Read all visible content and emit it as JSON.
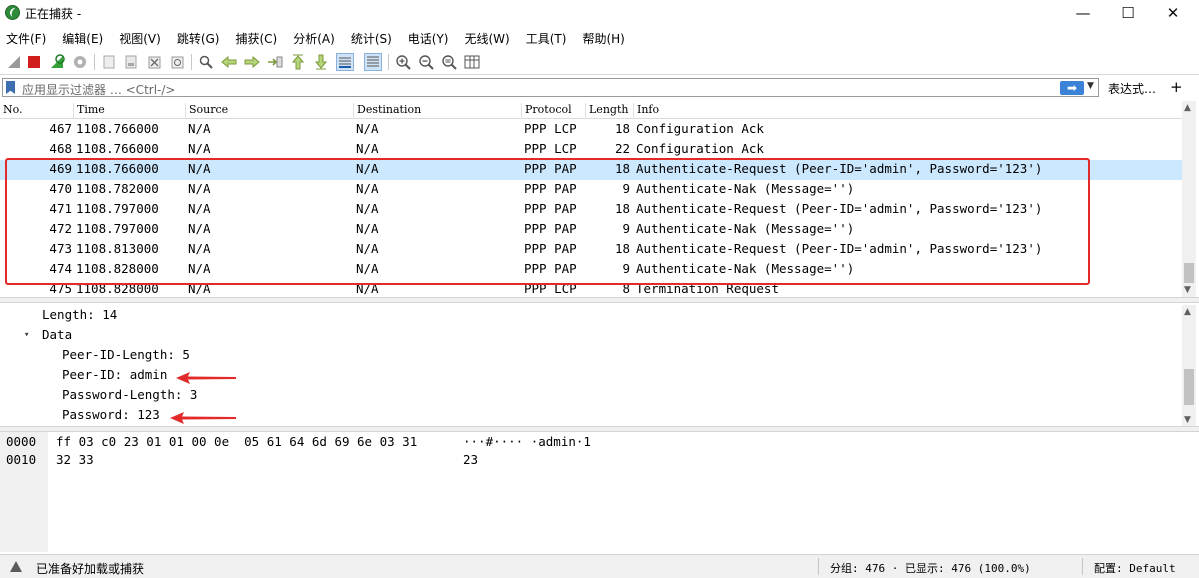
{
  "window": {
    "title": "正在捕获 -",
    "minimize_glyph": "—",
    "maximize_glyph": "☐",
    "close_glyph": "✕"
  },
  "menu": [
    "文件(F)",
    "编辑(E)",
    "视图(V)",
    "跳转(G)",
    "捕获(C)",
    "分析(A)",
    "统计(S)",
    "电话(Y)",
    "无线(W)",
    "工具(T)",
    "帮助(H)"
  ],
  "filter": {
    "placeholder": "应用显示过滤器 … <Ctrl-/>",
    "apply_glyph": "➡",
    "dropdown_glyph": "▼",
    "expression_label": "表达式…",
    "add_glyph": "+"
  },
  "packet_list": {
    "columns": [
      "No.",
      "Time",
      "Source",
      "Destination",
      "Protocol",
      "Length",
      "Info"
    ],
    "rows": [
      {
        "no": "467",
        "time": "1108.766000",
        "src": "N/A",
        "dst": "N/A",
        "proto": "PPP LCP",
        "len": "18",
        "info": "Configuration Ack"
      },
      {
        "no": "468",
        "time": "1108.766000",
        "src": "N/A",
        "dst": "N/A",
        "proto": "PPP LCP",
        "len": "22",
        "info": "Configuration Ack"
      },
      {
        "no": "469",
        "time": "1108.766000",
        "src": "N/A",
        "dst": "N/A",
        "proto": "PPP PAP",
        "len": "18",
        "info": "Authenticate-Request (Peer-ID='admin', Password='123')"
      },
      {
        "no": "470",
        "time": "1108.782000",
        "src": "N/A",
        "dst": "N/A",
        "proto": "PPP PAP",
        "len": "9",
        "info": "Authenticate-Nak (Message='')"
      },
      {
        "no": "471",
        "time": "1108.797000",
        "src": "N/A",
        "dst": "N/A",
        "proto": "PPP PAP",
        "len": "18",
        "info": "Authenticate-Request (Peer-ID='admin', Password='123')"
      },
      {
        "no": "472",
        "time": "1108.797000",
        "src": "N/A",
        "dst": "N/A",
        "proto": "PPP PAP",
        "len": "9",
        "info": "Authenticate-Nak (Message='')"
      },
      {
        "no": "473",
        "time": "1108.813000",
        "src": "N/A",
        "dst": "N/A",
        "proto": "PPP PAP",
        "len": "18",
        "info": "Authenticate-Request (Peer-ID='admin', Password='123')"
      },
      {
        "no": "474",
        "time": "1108.828000",
        "src": "N/A",
        "dst": "N/A",
        "proto": "PPP PAP",
        "len": "9",
        "info": "Authenticate-Nak (Message='')"
      },
      {
        "no": "475",
        "time": "1108.828000",
        "src": "N/A",
        "dst": "N/A",
        "proto": "PPP LCP",
        "len": "8",
        "info": "Termination Request"
      }
    ],
    "selected_no": "469"
  },
  "details": {
    "length_line": "Length: 14",
    "data_label": "Data",
    "peer_id_length": "Peer-ID-Length: 5",
    "peer_id": "Peer-ID: admin",
    "password_length": "Password-Length: 3",
    "password": "Password: 123",
    "annotation_color": "#e22a2a"
  },
  "bytes": {
    "rows": [
      {
        "offset": "0000",
        "hex": "ff 03 c0 23 01 01 00 0e  05 61 64 6d 69 6e 03 31",
        "ascii": "···#···· ·admin·1"
      },
      {
        "offset": "0010",
        "hex": "32 33",
        "ascii": "23"
      }
    ]
  },
  "status": {
    "ready_text": "已准备好加载或捕获",
    "stats": "分组: 476 · 已显示: 476 (100.0%)",
    "profile": "配置: Default"
  }
}
